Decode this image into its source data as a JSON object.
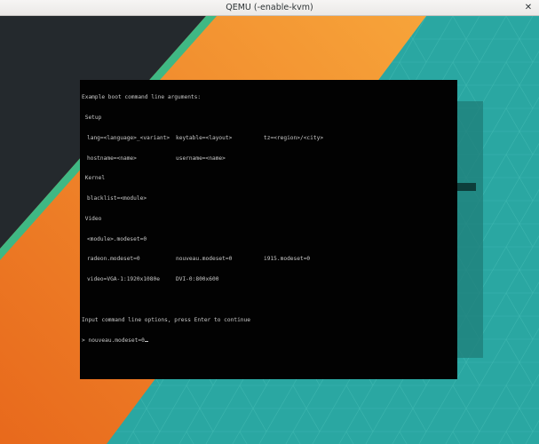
{
  "window": {
    "title": "QEMU (-enable-kvm)",
    "close_glyph": "✕"
  },
  "colors": {
    "dark_wall": "#24292d",
    "orange": "#ef7b22",
    "green_stripe": "#3fb884",
    "teal": "#2aa7a2",
    "terminal_bg": "#020202",
    "terminal_fg": "#c9c9c9"
  },
  "terminal": {
    "heading": "Example boot command line arguments:",
    "setup_label": "Setup",
    "lang": "lang=<language>_<variant>",
    "keytable": "keytable=<layout>",
    "tz": "tz=<region>/<city>",
    "hostname": "hostname=<name>",
    "username": "username=<name>",
    "kernel_label": "Kernel",
    "blacklist": "blacklist=<module>",
    "video_label": "Video",
    "module_modeset": "<module>.modeset=0",
    "radeon": "radeon.modeset=0",
    "nouveau": "nouveau.modeset=0",
    "i915": "i915.modeset=0",
    "video_vga": "video=VGA-1:1920x1080e",
    "video_dvi": "DVI-0:800x600",
    "prompt_message": "Input command line options, press Enter to continue",
    "prompt_symbol": ">",
    "input_value": "nouveau.modeset=0"
  }
}
